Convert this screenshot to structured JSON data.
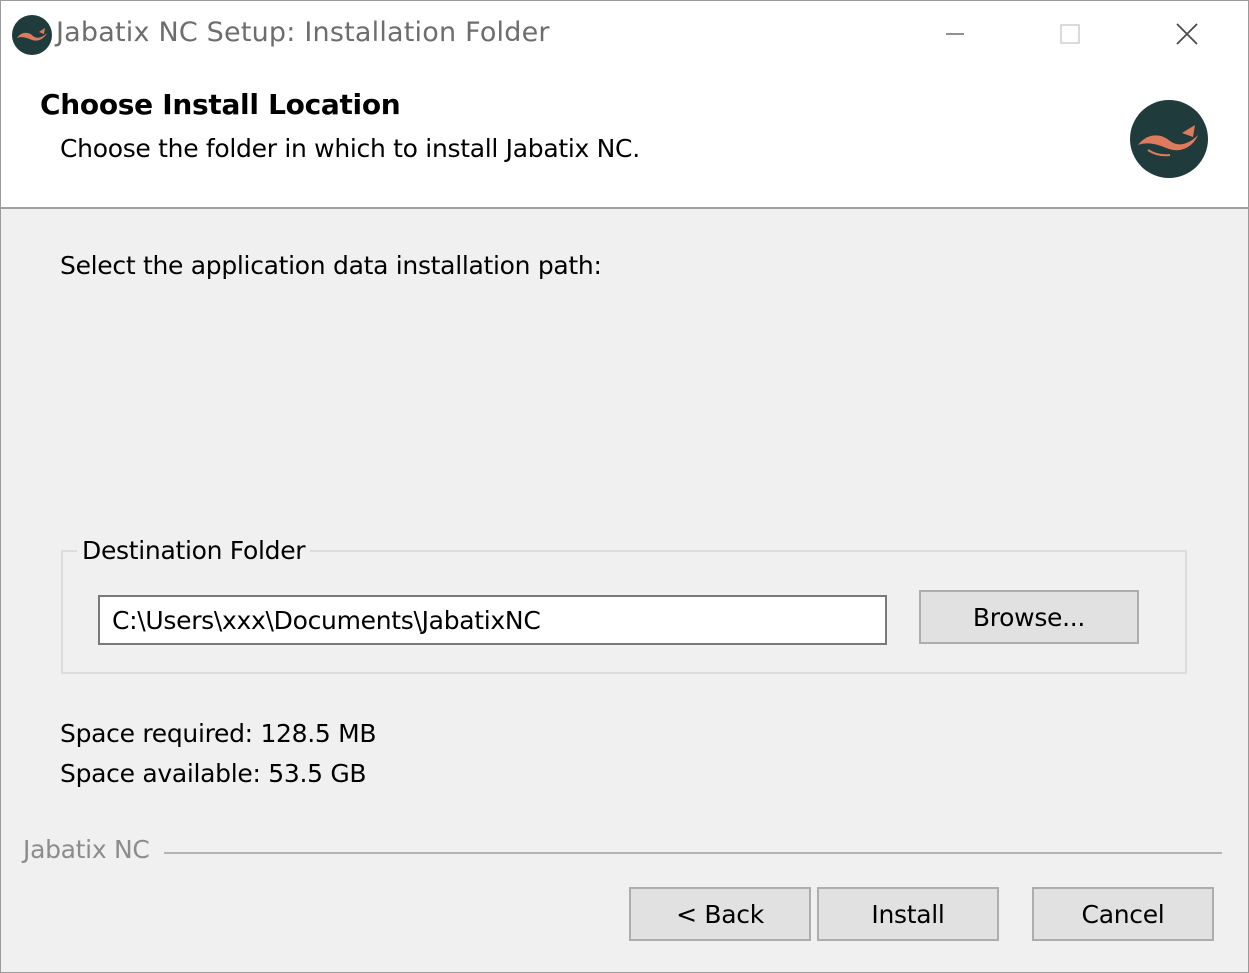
{
  "window": {
    "title": "Jabatix NC Setup: Installation Folder",
    "app_icon": "jabatix-logo-icon",
    "controls": {
      "minimize_icon": "minimize-icon",
      "maximize_icon": "maximize-icon",
      "close_icon": "close-icon"
    }
  },
  "header": {
    "title": "Choose Install Location",
    "subtitle": "Choose the folder in which to install Jabatix NC.",
    "logo_icon": "jabatix-logo-icon"
  },
  "body": {
    "instruction": "Select the application data installation path:",
    "destination": {
      "legend": "Destination Folder",
      "path": "C:\\Users\\xxx\\Documents\\JabatixNC",
      "browse_label": "Browse..."
    },
    "space_required": "Space required: 128.5 MB",
    "space_available": "Space available: 53.5 GB"
  },
  "footer": {
    "brand": "Jabatix NC",
    "back_label": "< Back",
    "install_label": "Install",
    "cancel_label": "Cancel"
  },
  "colors": {
    "dialog_background": "#f0f0f0",
    "header_background": "#ffffff",
    "logo_dark": "#1f3b3b",
    "logo_accent": "#e07a5f",
    "title_text": "#6d6d6d",
    "button_face": "#e1e1e1"
  }
}
